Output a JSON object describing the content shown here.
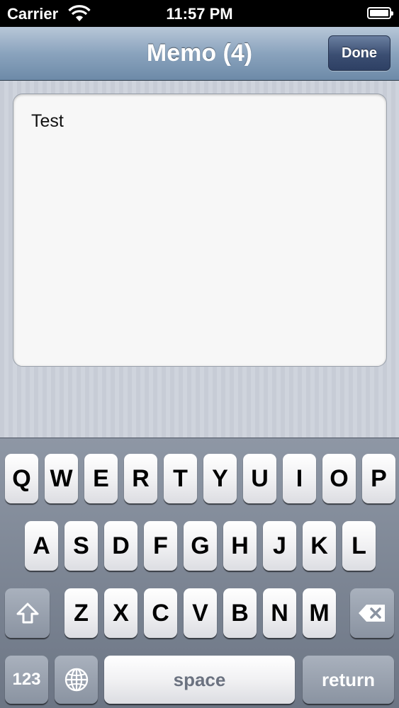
{
  "status_bar": {
    "carrier": "Carrier",
    "time": "11:57 PM"
  },
  "nav": {
    "title": "Memo (4)",
    "done_label": "Done"
  },
  "memo": {
    "text": "Test"
  },
  "keyboard": {
    "row1": [
      "Q",
      "W",
      "E",
      "R",
      "T",
      "Y",
      "U",
      "I",
      "O",
      "P"
    ],
    "row2": [
      "A",
      "S",
      "D",
      "F",
      "G",
      "H",
      "J",
      "K",
      "L"
    ],
    "row3": [
      "Z",
      "X",
      "C",
      "V",
      "B",
      "N",
      "M"
    ],
    "numbers_label": "123",
    "space_label": "space",
    "return_label": "return",
    "icons": {
      "shift": "shift-icon",
      "delete": "delete-icon",
      "globe": "globe-icon"
    }
  }
}
